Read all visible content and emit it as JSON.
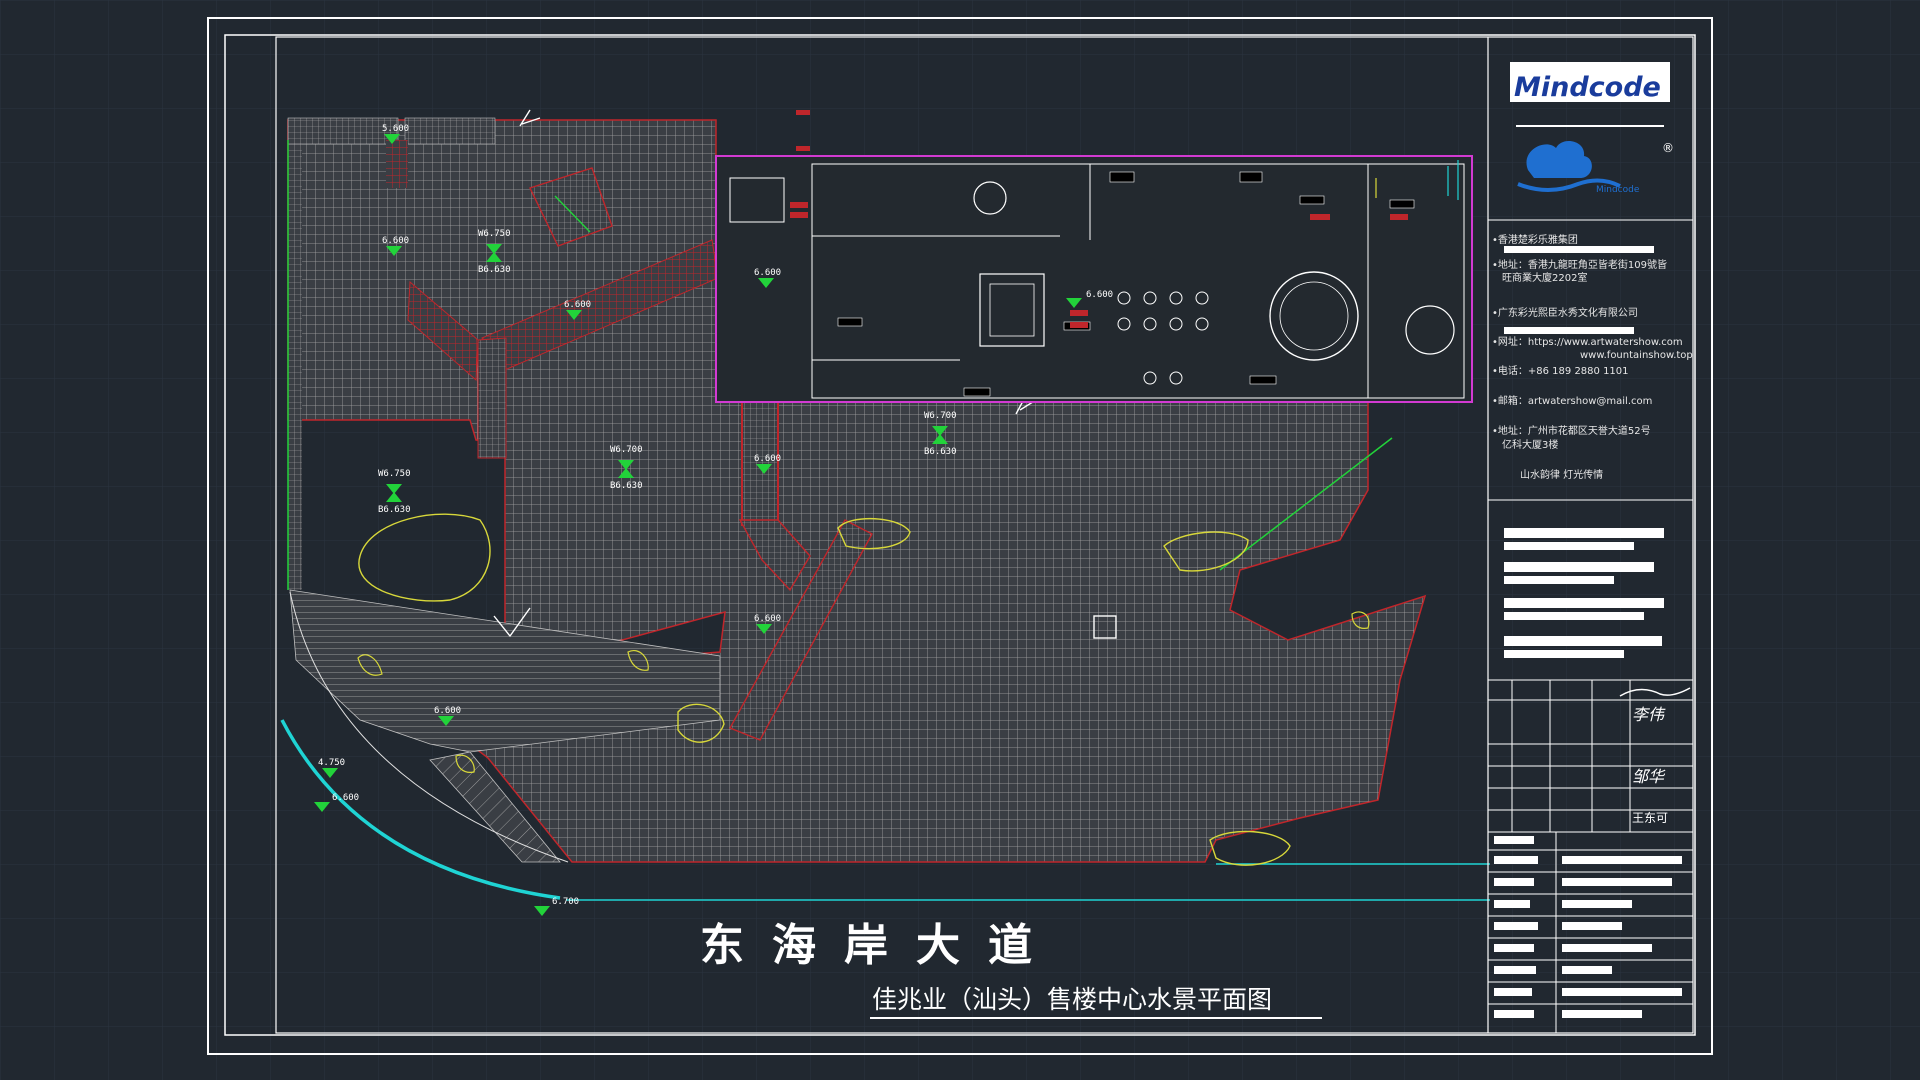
{
  "drawing": {
    "road_name": "东海岸大道",
    "title": "佳兆业（汕头）售楼中心水景平面图"
  },
  "colors": {
    "background": "#212830",
    "grid": "#2b3440",
    "frame": "#ffffff",
    "paving": "#a8a8a8",
    "wall_red": "#c0262b",
    "green": "#22d33a",
    "cyan": "#1fd4d4",
    "yellow": "#d8d83a",
    "magenta": "#d23ad2"
  },
  "title_block": {
    "logo_text": "Mindcode",
    "registered_mark": "®",
    "brand_text": "Mindcode",
    "company_lines": [
      "•香港楚彩乐雅集团",
      "•地址：香港九龍旺角亞皆老街109號皆",
      "旺商業大廈2202室",
      "•广东彩光熙臣水秀文化有限公司",
      "•网址：https://www.artwatershow.com",
      "www.fountainshow.top",
      "•电话：+86 189 2880 1101",
      "•邮箱：artwatershow@mail.com",
      "•地址：广州市花都区天誉大道52号",
      "亿科大厦3楼",
      "山水韵律   灯光传情"
    ],
    "signatures": [
      "李伟",
      "邹华",
      "王东可"
    ]
  },
  "elevations": [
    "5.600",
    "6.600",
    "W6.750",
    "B6.630",
    "6.600",
    "6.600",
    "W6.750",
    "B6.630",
    "W6.700",
    "B6.630",
    "W6.700",
    "B6.630",
    "6.600",
    "6.600",
    "6.600",
    "6.600",
    "4.750",
    "6.600",
    "6.700"
  ]
}
